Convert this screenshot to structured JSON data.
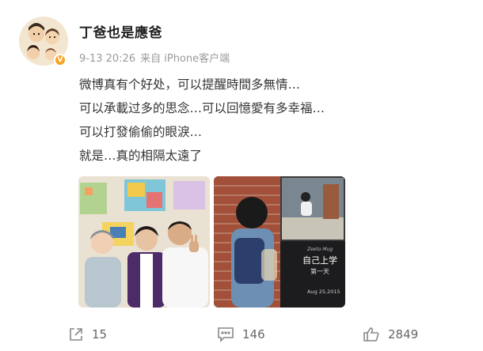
{
  "user": {
    "name": "丁爸也是應爸"
  },
  "post": {
    "time": "9-13 20:26",
    "source": "来自 iPhone客户端",
    "lines": [
      "微博真有个好处，可以提醒時間多無情…",
      "可以承載过多的思念…可以回憶愛有多幸福…",
      "可以打發偷偷的眼淚…",
      "就是…真的相隔太遠了"
    ]
  },
  "photo2_card": {
    "small": "Zeeto Mug",
    "title": "自己上学",
    "subtitle": "第一天",
    "date": "Aug 25,2015"
  },
  "actions": {
    "reposts": "15",
    "comments": "146",
    "likes": "2849"
  },
  "icons": [
    "avatar",
    "verified-badge-icon",
    "repost-icon",
    "comment-icon",
    "like-icon"
  ],
  "colors": {
    "accent_badge": "#f5a623",
    "meta_gray": "#9a9a9a"
  }
}
